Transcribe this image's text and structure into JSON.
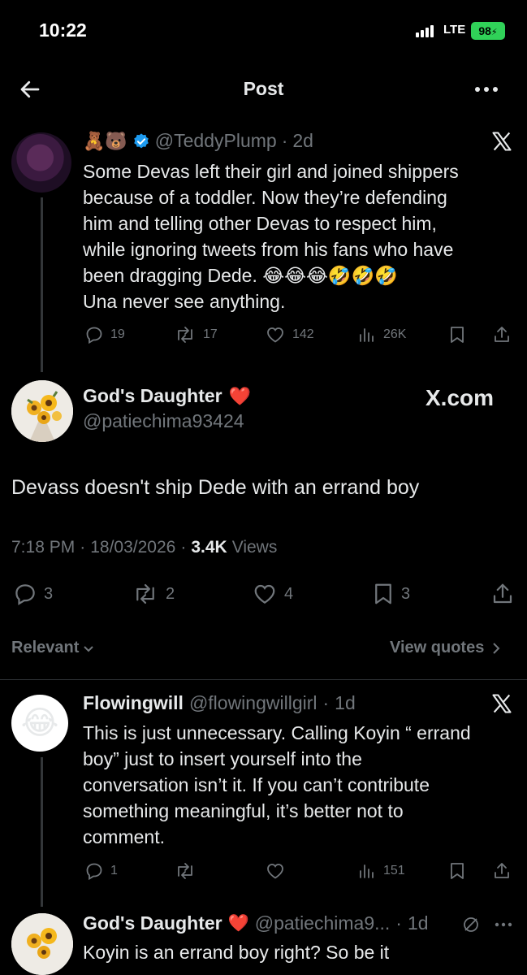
{
  "status_bar": {
    "time": "10:22",
    "network": "LTE",
    "battery": "98"
  },
  "header": {
    "title": "Post"
  },
  "parent_post": {
    "emojis": "🧸🐻",
    "handle": "@TeddyPlump",
    "age": "2d",
    "lines": [
      "Some Devas left their girl and joined shippers",
      "because of a toddler. Now they’re defending",
      "him and telling other Devas to respect him,",
      "while ignoring tweets from his fans who have",
      "been dragging Dede. 😂😂😂🤣🤣🤣",
      "Una never see anything."
    ],
    "replies": "19",
    "reposts": "17",
    "likes": "142",
    "views": "26K"
  },
  "main_post": {
    "name": "God's Daughter",
    "heart": "❤️",
    "handle": "@patiechima93424",
    "watermark": "X.com",
    "text": "Devass doesn't ship Dede with an errand boy",
    "time": "7:18 PM",
    "date": "18/03/2026",
    "views_count": "3.4K",
    "views_label": "Views",
    "replies": "3",
    "reposts": "2",
    "likes": "4",
    "bookmarks": "3"
  },
  "filter": {
    "relevant": "Relevant",
    "view_quotes": "View quotes"
  },
  "reply_post": {
    "name": "Flowingwill",
    "handle": "@flowingwillgirl",
    "age": "1d",
    "avatar_emoji": "😂",
    "lines": [
      "This is just unnecessary. Calling Koyin “ errand",
      "boy” just to insert yourself into the",
      "conversation isn’t it. If you can’t contribute",
      "something meaningful, it’s better not to",
      "comment."
    ],
    "replies": "1",
    "views": "151"
  },
  "reply2": {
    "name": "God's Daughter",
    "heart": "❤️",
    "handle": "@patiechima9...",
    "age": "1d",
    "text": "Koyin is an errand boy right? So be it"
  },
  "colors": {
    "background": "#000000",
    "text": "#e7e9ea",
    "muted": "#71767b",
    "verified": "#1d9bf0",
    "battery": "#30d158"
  }
}
